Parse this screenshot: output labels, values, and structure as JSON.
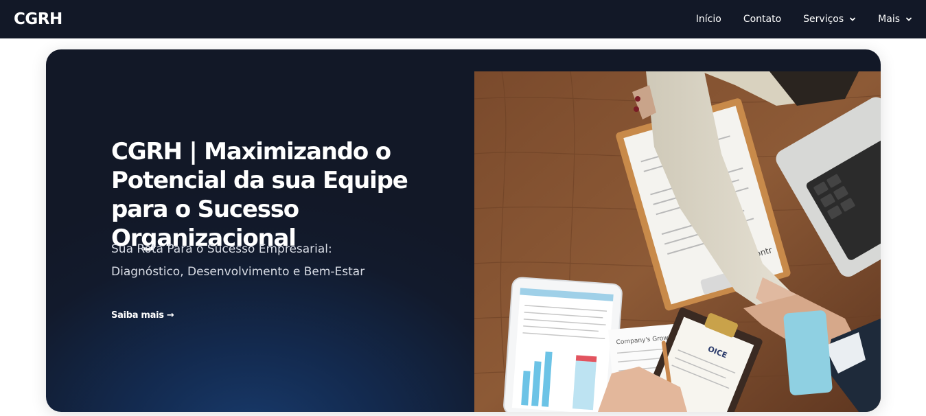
{
  "header": {
    "brand": "CGRH",
    "nav": [
      {
        "label": "Início",
        "has_dropdown": false
      },
      {
        "label": "Contato",
        "has_dropdown": false
      },
      {
        "label": "Serviços",
        "has_dropdown": true
      },
      {
        "label": "Mais",
        "has_dropdown": true
      }
    ]
  },
  "hero": {
    "title": "CGRH | Maximizando o Potencial da sua Equipe para o Sucesso Organizacional",
    "subtitle": "Sua Rota Para o Sucesso Empresarial: Diagnóstico, Desenvolvimento e Bem-Estar",
    "cta": "Saiba mais →",
    "image_doc_label": "Company's Growth",
    "image_doc_label2": "Contr",
    "image_stamp": "OICE"
  },
  "colors": {
    "topbar": "#121827",
    "hero_bg": "#121827",
    "hero_glow": "#183a6b",
    "text": "#ffffff"
  }
}
